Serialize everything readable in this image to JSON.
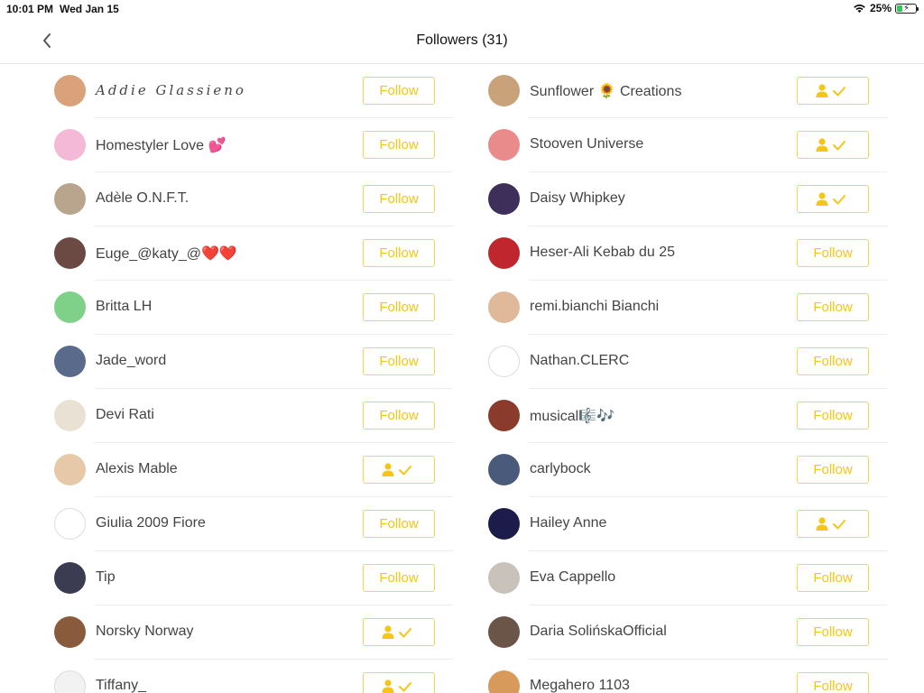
{
  "status": {
    "time": "10:01 PM",
    "date": "Wed Jan 15",
    "battery": "25%"
  },
  "header": {
    "title": "Followers (31)"
  },
  "follow_label": "Follow",
  "accent_color": "#f5c518",
  "left_column": [
    {
      "name": "Addie Glassieno",
      "state": "follow",
      "avatar": "#d9a27a",
      "script": true
    },
    {
      "name": "Homestyler Love 💕",
      "state": "follow",
      "avatar": "#f3b9d6"
    },
    {
      "name": "Adèle O.N.F.T.",
      "state": "follow",
      "avatar": "#b9a58e"
    },
    {
      "name": "Euge_@katy_@❤️❤️",
      "state": "follow",
      "avatar": "#6b4a44"
    },
    {
      "name": "Britta LH",
      "state": "follow",
      "avatar": "#7fd18a"
    },
    {
      "name": "Jade_word",
      "state": "follow",
      "avatar": "#5a6a8a"
    },
    {
      "name": "Devi Rati",
      "state": "follow",
      "avatar": "#e9e2d4"
    },
    {
      "name": "Alexis Mable",
      "state": "following",
      "avatar": "#e6c9a8"
    },
    {
      "name": "Giulia 2009 Fiore",
      "state": "follow",
      "avatar": "#ffffff"
    },
    {
      "name": "Tip",
      "state": "follow",
      "avatar": "#3b3b52"
    },
    {
      "name": "Norsky Norway",
      "state": "following",
      "avatar": "#8a5a3c"
    },
    {
      "name": "Tiffany_",
      "state": "following",
      "avatar": "#f2f2f2"
    }
  ],
  "right_column": [
    {
      "name": "Sunflower 🌻 Creations",
      "state": "following",
      "avatar": "#c9a27a"
    },
    {
      "name": "Stooven Universe",
      "state": "following",
      "avatar": "#e98b8b"
    },
    {
      "name": "Daisy Whipkey",
      "state": "following",
      "avatar": "#3d2f5a"
    },
    {
      "name": "Heser-Ali Kebab du 25",
      "state": "follow",
      "avatar": "#c0262d"
    },
    {
      "name": "remi.bianchi Bianchi",
      "state": "follow",
      "avatar": "#e0b89a"
    },
    {
      "name": "Nathan.CLERC",
      "state": "follow",
      "avatar": "#ffffff"
    },
    {
      "name": "musical🎼🎶",
      "state": "follow",
      "avatar": "#8a3b2c"
    },
    {
      "name": "carlybock",
      "state": "follow",
      "avatar": "#4a5a7a"
    },
    {
      "name": "Hailey Anne",
      "state": "following",
      "avatar": "#1c1c4a"
    },
    {
      "name": "Eva Cappello",
      "state": "follow",
      "avatar": "#c9c2bb"
    },
    {
      "name": "Daria SolińskaOfficial",
      "state": "follow",
      "avatar": "#6b5548"
    },
    {
      "name": "Megahero 1103",
      "state": "follow",
      "avatar": "#d89a5a"
    }
  ]
}
